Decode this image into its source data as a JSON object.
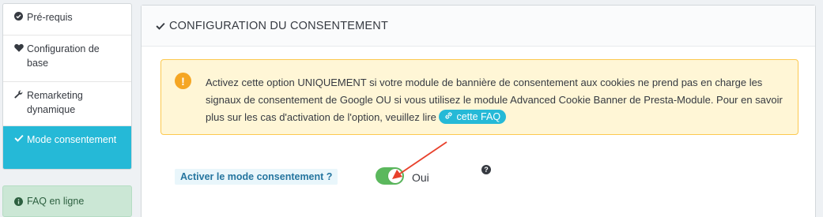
{
  "sidebar": {
    "items": [
      {
        "label": "Pré-requis",
        "icon": "check-circle-icon",
        "active": false
      },
      {
        "label": "Configuration de base",
        "icon": "heart-icon",
        "active": false
      },
      {
        "label": "Remarketing dynamique",
        "icon": "wrench-icon",
        "active": false
      },
      {
        "label": "Mode consentement",
        "icon": "check-icon",
        "active": true
      }
    ],
    "faq": {
      "label": "FAQ en ligne",
      "icon": "info-circle-icon"
    }
  },
  "panel": {
    "title": "CONFIGURATION DU CONSENTEMENT",
    "title_icon": "check-icon",
    "alert": {
      "icon": "warning-icon",
      "text": "Activez cette option UNIQUEMENT si votre module de bannière de consentement aux cookies ne prend pas en charge les signaux de consentement de Google OU si vous utilisez le module Advanced Cookie Banner de Presta-Module. Pour en savoir plus sur les cas d'activation de l'option, veuillez lire",
      "link_label": "cette FAQ",
      "link_icon": "link-icon"
    },
    "setting": {
      "label": "Activer le mode consentement ?",
      "toggle_state": "on",
      "toggle_text": "Oui",
      "help_icon": "question-icon"
    }
  },
  "colors": {
    "accent": "#25b9d7",
    "toggle_on": "#5bb85d",
    "alert_bg": "#fff6d6",
    "alert_border": "#fcc94f",
    "annotation_arrow": "#e8412c"
  }
}
